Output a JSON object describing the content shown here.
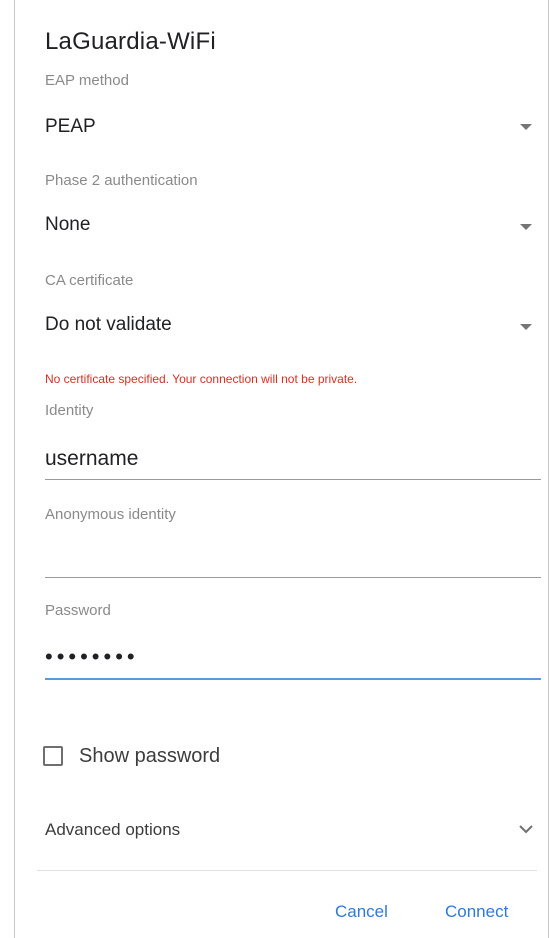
{
  "dialog": {
    "title": "LaGuardia-WiFi"
  },
  "eap_method": {
    "label": "EAP method",
    "value": "PEAP"
  },
  "phase2": {
    "label": "Phase 2 authentication",
    "value": "None"
  },
  "ca_certificate": {
    "label": "CA certificate",
    "value": "Do not validate",
    "warning": "No certificate specified. Your connection will not be private."
  },
  "identity": {
    "label": "Identity",
    "value": "username"
  },
  "anonymous_identity": {
    "label": "Anonymous identity",
    "value": ""
  },
  "password": {
    "label": "Password",
    "masked_value": "••••••••"
  },
  "show_password": {
    "label": "Show password",
    "checked": false
  },
  "advanced": {
    "label": "Advanced options"
  },
  "actions": {
    "cancel": "Cancel",
    "connect": "Connect"
  },
  "colors": {
    "accent": "#2f7ad8",
    "warning": "#d93025",
    "focus_underline": "#5b9bd5"
  },
  "icons": {
    "dropdown": "caret-down-icon",
    "advanced": "chevron-down-icon",
    "checkbox": "checkbox-unchecked-icon"
  }
}
